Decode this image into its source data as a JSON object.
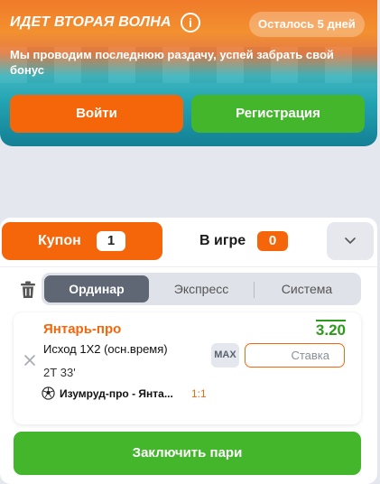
{
  "banner": {
    "title": "Идет вторая волна",
    "days_left": "Осталось 5 дней",
    "subtitle": "Мы проводим последнюю раздачу, успей забрать свой бонус",
    "login_label": "Войти",
    "register_label": "Регистрация",
    "info_icon": "info-icon"
  },
  "tabs": {
    "coupon_label": "Купон",
    "coupon_count": "1",
    "ingame_label": "В игре",
    "ingame_count": "0",
    "expand_icon": "chevron-down-icon"
  },
  "bet_types": {
    "single": "Ординар",
    "express": "Экспресс",
    "system": "Система",
    "selected": "Ординар"
  },
  "bet": {
    "team": "Янтарь-про",
    "market": "Исход 1Х2 (осн.время)",
    "period": "2Т 33'",
    "match": "Изумруд-про - Янта...",
    "score": "1:1",
    "odds": "3.20",
    "max_label": "MAX",
    "stake_placeholder": "Ставка"
  },
  "submit_label": "Заключить пари",
  "colors": {
    "accent": "#f5660a",
    "success": "#43b62c",
    "odds": "#2c9a1a",
    "segment_active": "#5f6674"
  }
}
